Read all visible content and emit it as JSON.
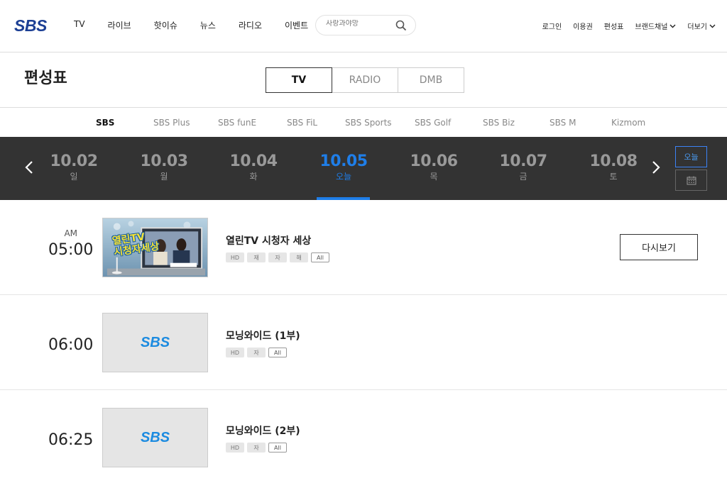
{
  "header": {
    "logo": "SBS",
    "nav": [
      "TV",
      "라이브",
      "핫이슈",
      "뉴스",
      "라디오",
      "이벤트"
    ],
    "search_placeholder": "사랑과야망",
    "util": {
      "login": "로그인",
      "voucher": "이용권",
      "schedule": "편성표",
      "brand_channel": "브랜드채널",
      "more": "더보기"
    }
  },
  "page": {
    "title": "편성표",
    "type_tabs": [
      "TV",
      "RADIO",
      "DMB"
    ],
    "active_type": "TV"
  },
  "channels": [
    "SBS",
    "SBS Plus",
    "SBS funE",
    "SBS FiL",
    "SBS Sports",
    "SBS Golf",
    "SBS Biz",
    "SBS M",
    "Kizmom"
  ],
  "active_channel": "SBS",
  "dates": [
    {
      "date": "10.02",
      "day": "일"
    },
    {
      "date": "10.03",
      "day": "월"
    },
    {
      "date": "10.04",
      "day": "화"
    },
    {
      "date": "10.05",
      "day": "오늘"
    },
    {
      "date": "10.06",
      "day": "목"
    },
    {
      "date": "10.07",
      "day": "금"
    },
    {
      "date": "10.08",
      "day": "토"
    }
  ],
  "active_date_index": 3,
  "today_label": "오늘",
  "programs": [
    {
      "ampm": "AM",
      "time": "05:00",
      "title": "열린TV 시청자 세상",
      "badges": [
        "HD",
        "재",
        "자",
        "해"
      ],
      "rating": "All",
      "replay": "다시보기",
      "thumb_title_line1": "열린TV",
      "thumb_title_line2": "시청자세상"
    },
    {
      "ampm": "",
      "time": "06:00",
      "title": "모닝와이드 (1부)",
      "badges": [
        "HD",
        "자"
      ],
      "rating": "All",
      "thumb_logo": "SBS"
    },
    {
      "ampm": "",
      "time": "06:25",
      "title": "모닝와이드 (2부)",
      "badges": [
        "HD",
        "자"
      ],
      "rating": "All",
      "thumb_logo": "SBS"
    }
  ],
  "colors": {
    "accent": "#1f7ee8",
    "logo": "#1c3f94",
    "date_bar": "#333333"
  }
}
